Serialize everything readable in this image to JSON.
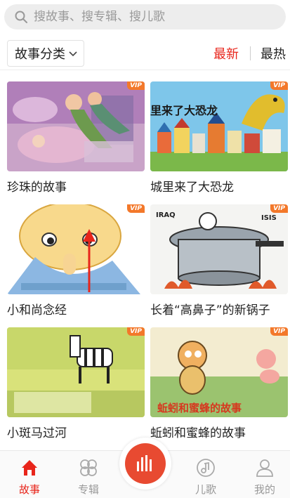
{
  "search": {
    "placeholder": "搜故事、搜专辑、搜儿歌"
  },
  "filter": {
    "category_label": "故事分类",
    "sort_latest": "最新",
    "sort_hottest": "最热"
  },
  "stories": [
    {
      "title": "珍珠的故事",
      "badge": "VIP"
    },
    {
      "title": "城里来了大恐龙",
      "badge": "VIP"
    },
    {
      "title": "小和尚念经",
      "badge": "VIP"
    },
    {
      "title": "长着“高鼻子”的新锅子",
      "badge": "VIP"
    },
    {
      "title": "小斑马过河",
      "badge": "VIP"
    },
    {
      "title": "蚯蚓和蜜蜂的故事",
      "badge": "VIP"
    }
  ],
  "thumb_text": {
    "dino_caption": "里来了大恐龙",
    "pot_label_left": "IRAQ",
    "pot_label_right": "ISIS",
    "worm_caption": "蚯蚓和蜜蜂的故事"
  },
  "tabs": [
    {
      "label": "故事",
      "icon": "home-icon",
      "active": true
    },
    {
      "label": "专辑",
      "icon": "album-grid-icon",
      "active": false
    },
    {
      "label": "儿歌",
      "icon": "music-note-icon",
      "active": false
    },
    {
      "label": "我的",
      "icon": "user-icon",
      "active": false
    }
  ],
  "colors": {
    "accent": "#e8251b",
    "play": "#e84a31",
    "vip": "#f3782a"
  }
}
